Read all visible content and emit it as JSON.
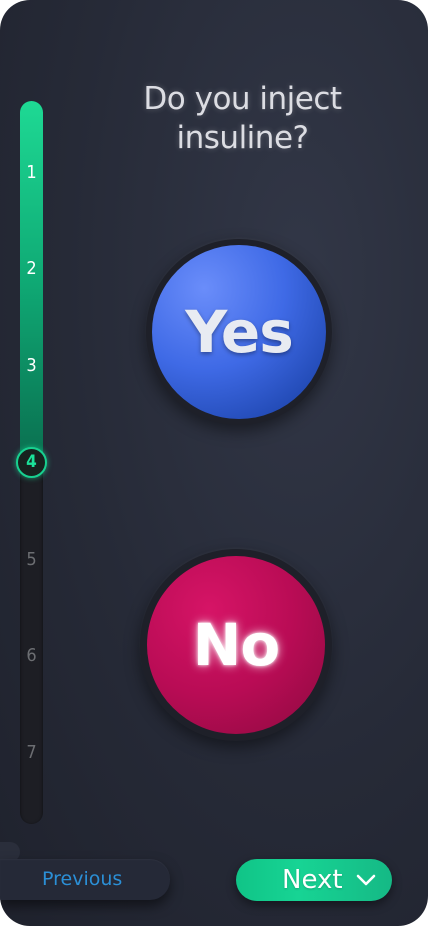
{
  "question": {
    "line1": "Do you inject",
    "line2": "insuline?"
  },
  "answers": {
    "yes_label": "Yes",
    "no_label": "No"
  },
  "progress": {
    "steps": [
      "1",
      "2",
      "3",
      "4",
      "5",
      "6",
      "7"
    ],
    "current_step": "4",
    "completed_steps": 3,
    "total_steps": 7
  },
  "navigation": {
    "previous_label": "Previous",
    "next_label": "Next",
    "next_icon": "chevron-down-icon"
  },
  "colors": {
    "accent_green": "#18d090",
    "yes_blue": "#3f6ae6",
    "no_magenta": "#b90c55",
    "previous_text": "#2b8fd6",
    "background": "#262a37"
  }
}
